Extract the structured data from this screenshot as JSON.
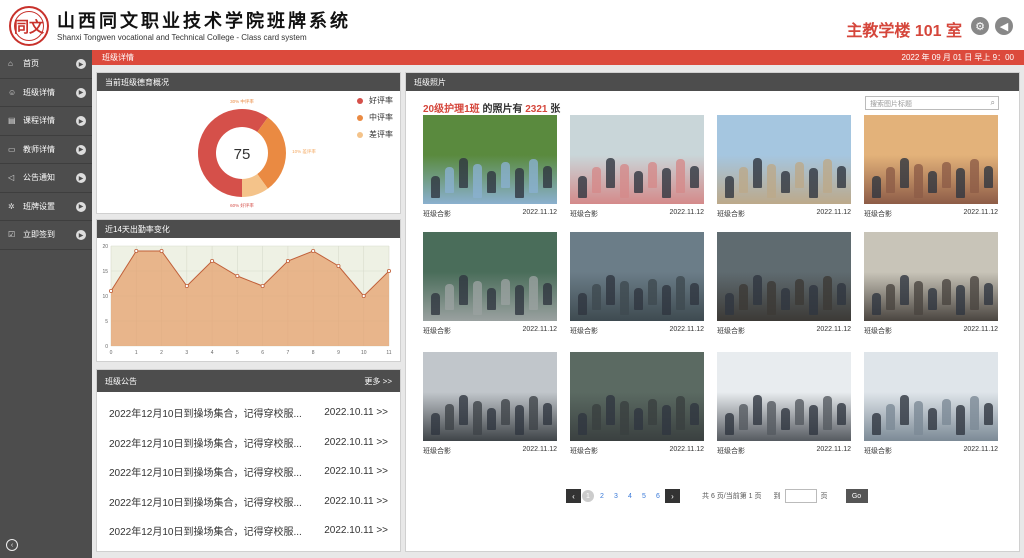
{
  "header": {
    "logo_text": "同文",
    "title": "山西同文职业技术学院班牌系统",
    "subtitle": "Shanxi Tongwen vocational and Technical College - Class card system",
    "room": "主教学楼 101 室",
    "icons": [
      "gear-icon",
      "megaphone-icon"
    ]
  },
  "sidebar": {
    "items": [
      {
        "label": "首页",
        "icon": "home-icon"
      },
      {
        "label": "班级详情",
        "icon": "users-icon"
      },
      {
        "label": "课程详情",
        "icon": "book-icon"
      },
      {
        "label": "教师详情",
        "icon": "id-card-icon"
      },
      {
        "label": "公告通知",
        "icon": "bullhorn-icon"
      },
      {
        "label": "班牌设置",
        "icon": "cog-icon"
      },
      {
        "label": "立即签到",
        "icon": "check-square-icon"
      }
    ]
  },
  "topbar": {
    "section": "班级详情",
    "datetime": "2022 年 09 月 01 日  早上 9：00"
  },
  "moral_panel": {
    "title": "当前班级德育概况",
    "center_value": "75",
    "labels": {
      "mid": "30% 中评率",
      "low": "10% 差评率",
      "good": "60% 好评率"
    }
  },
  "attendance_panel": {
    "title": "近14天出勤率变化"
  },
  "notice_panel": {
    "title": "班级公告",
    "more": "更多 >>",
    "items": [
      {
        "text": "2022年12月10日到操场集合，记得穿校服...",
        "date": "2022.10.11 >>"
      },
      {
        "text": "2022年12月10日到操场集合，记得穿校服...",
        "date": "2022.10.11 >>"
      },
      {
        "text": "2022年12月10日到操场集合，记得穿校服...",
        "date": "2022.10.11 >>"
      },
      {
        "text": "2022年12月10日到操场集合，记得穿校服...",
        "date": "2022.10.11 >>"
      },
      {
        "text": "2022年12月10日到操场集合，记得穿校服...",
        "date": "2022.10.11 >>"
      }
    ]
  },
  "photos_panel": {
    "title": "班级照片",
    "class_name": "20级护理1班",
    "mid_text": " 的照片有 ",
    "count": "2321",
    "unit": " 张",
    "search_placeholder": "搜索图片标题",
    "photos": [
      {
        "caption": "班级合影",
        "date": "2022.11.12",
        "palette": [
          "#5a8a3e",
          "#8ab0cf"
        ]
      },
      {
        "caption": "班级合影",
        "date": "2022.11.12",
        "palette": [
          "#c9d6d9",
          "#d48a8a"
        ]
      },
      {
        "caption": "班级合影",
        "date": "2022.11.12",
        "palette": [
          "#a5c6e0",
          "#bca98a"
        ]
      },
      {
        "caption": "班级合影",
        "date": "2022.11.12",
        "palette": [
          "#e3b27a",
          "#8d5c47"
        ]
      },
      {
        "caption": "班级合影",
        "date": "2022.11.12",
        "palette": [
          "#4a6d5a",
          "#9aa1a0"
        ]
      },
      {
        "caption": "班级合影",
        "date": "2022.11.12",
        "palette": [
          "#6b7d88",
          "#3e4a50"
        ]
      },
      {
        "caption": "班级合影",
        "date": "2022.11.12",
        "palette": [
          "#5f6b70",
          "#3c3a36"
        ]
      },
      {
        "caption": "班级合影",
        "date": "2022.11.12",
        "palette": [
          "#c8c4b8",
          "#4a4540"
        ]
      },
      {
        "caption": "班级合影",
        "date": "2022.11.12",
        "palette": [
          "#c1c6cb",
          "#3f4448"
        ]
      },
      {
        "caption": "班级合影",
        "date": "2022.11.12",
        "palette": [
          "#5b6a62",
          "#3a4040"
        ]
      },
      {
        "caption": "班级合影",
        "date": "2022.11.12",
        "palette": [
          "#e8ecef",
          "#555a60"
        ]
      },
      {
        "caption": "班级合影",
        "date": "2022.11.12",
        "palette": [
          "#dfe5ea",
          "#7c8a96"
        ]
      }
    ],
    "pagination": {
      "pages": [
        "1",
        "2",
        "3",
        "4",
        "5",
        "6"
      ],
      "current": "1",
      "summary": "共 6 页/当前第 1 页",
      "goto_label": "到",
      "page_unit": "页",
      "go_label": "Go"
    }
  },
  "chart_data": [
    {
      "type": "pie",
      "title": "当前班级德育概况",
      "categories": [
        "好评率",
        "中评率",
        "差评率"
      ],
      "values": [
        60,
        30,
        10
      ],
      "colors": [
        "#d5504a",
        "#ea8a42",
        "#f4c38a"
      ],
      "center_label": "75",
      "legend": "right"
    },
    {
      "type": "area",
      "title": "近14天出勤率变化",
      "x": [
        0,
        1,
        2,
        3,
        4,
        5,
        6,
        7,
        8,
        9,
        10,
        11
      ],
      "values": [
        11,
        19,
        19,
        12,
        17,
        14,
        12,
        17,
        19,
        16,
        10,
        15
      ],
      "ylim": [
        0,
        20
      ],
      "yticks": [
        0,
        5,
        10,
        15,
        20
      ],
      "grid": true,
      "color": "#e6a06e"
    }
  ]
}
